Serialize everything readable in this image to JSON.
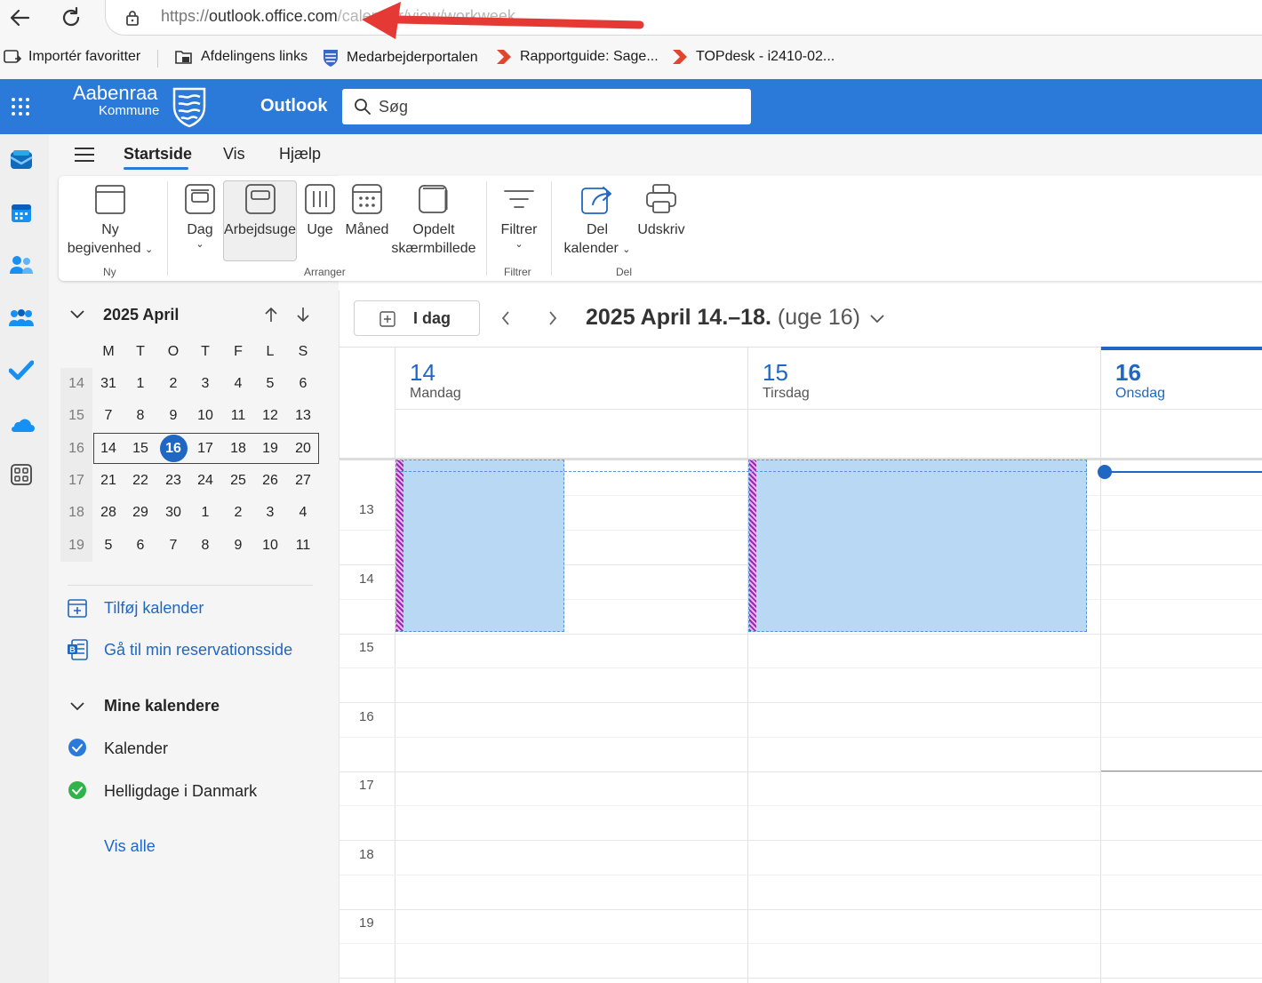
{
  "browser": {
    "url_prefix": "https://",
    "url_host": "outlook.office.com",
    "url_rest": "/calendar/view/workweek",
    "favorites": [
      {
        "label": "Importér favoritter"
      },
      {
        "label": "Afdelingens links"
      },
      {
        "label": "Medarbejderportalen"
      },
      {
        "label": "Rapportguide: Sage..."
      },
      {
        "label": "TOPdesk - i2410-02..."
      }
    ]
  },
  "header": {
    "org_name": "Aabenraa",
    "org_sub": "Kommune",
    "app_name": "Outlook",
    "search_placeholder": "Søg"
  },
  "tabs": [
    "Startside",
    "Vis",
    "Hjælp"
  ],
  "ribbon": {
    "new_event": [
      "Ny",
      "begivenhed"
    ],
    "day": "Dag",
    "workweek": "Arbejdsuge",
    "week": "Uge",
    "month": "Måned",
    "split": [
      "Opdelt",
      "skærmbillede"
    ],
    "filter": "Filtrer",
    "share": [
      "Del",
      "kalender"
    ],
    "print": "Udskriv",
    "groups": {
      "new": "Ny",
      "arrange": "Arranger",
      "filter": "Filtrer",
      "share": "Del"
    }
  },
  "minical": {
    "title": "2025 April",
    "weekdays": [
      "M",
      "T",
      "O",
      "T",
      "F",
      "L",
      "S"
    ],
    "weeks": [
      {
        "wk": "14",
        "days": [
          "31",
          "1",
          "2",
          "3",
          "4",
          "5",
          "6"
        ]
      },
      {
        "wk": "15",
        "days": [
          "7",
          "8",
          "9",
          "10",
          "11",
          "12",
          "13"
        ]
      },
      {
        "wk": "16",
        "days": [
          "14",
          "15",
          "16",
          "17",
          "18",
          "19",
          "20"
        ]
      },
      {
        "wk": "17",
        "days": [
          "21",
          "22",
          "23",
          "24",
          "25",
          "26",
          "27"
        ]
      },
      {
        "wk": "18",
        "days": [
          "28",
          "29",
          "30",
          "1",
          "2",
          "3",
          "4"
        ]
      },
      {
        "wk": "19",
        "days": [
          "5",
          "6",
          "7",
          "8",
          "9",
          "10",
          "11"
        ]
      }
    ],
    "today": "16"
  },
  "sidebar": {
    "add_calendar": "Tilføj kalender",
    "booking_page": "Gå til min reservationsside",
    "my_calendars": "Mine kalendere",
    "calendars": [
      {
        "label": "Kalender",
        "color": "#2b79d9"
      },
      {
        "label": "Helligdage i Danmark",
        "color": "#2fb34a"
      }
    ],
    "show_all": "Vis alle"
  },
  "calendar": {
    "today_button": "I dag",
    "range_title": "2025 April 14.–18.",
    "week_label": "(uge 16)",
    "days": [
      {
        "num": "14",
        "name": "Mandag",
        "today": false
      },
      {
        "num": "15",
        "name": "Tirsdag",
        "today": false
      },
      {
        "num": "16",
        "name": "Onsdag",
        "today": true
      }
    ],
    "hours": [
      "13",
      "14",
      "15",
      "16",
      "17",
      "18",
      "19"
    ]
  },
  "colors": {
    "brand": "#2b79d9",
    "event_fill": "#b8d8f3",
    "event_stripe": "#9c27b0",
    "annotation_arrow": "#e53935"
  }
}
